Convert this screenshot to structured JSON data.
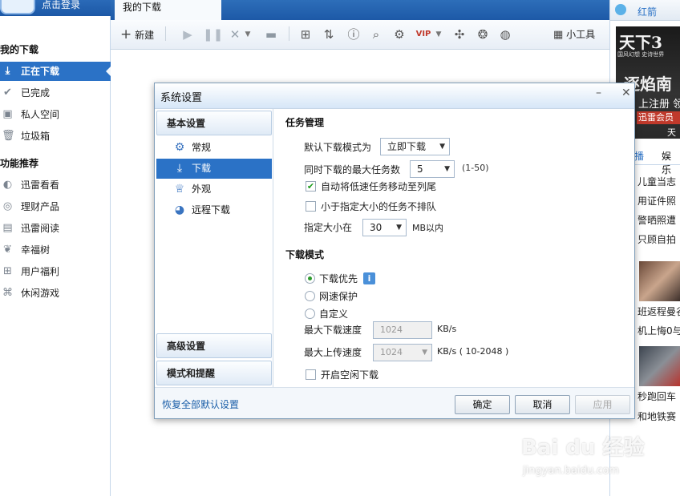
{
  "left": {
    "login": "点击登录",
    "my_downloads_title": "我的下载",
    "downloading": "正在下载",
    "completed": "已完成",
    "private_space": "私人空间",
    "trash": "垃圾箱",
    "recommend_title": "功能推荐",
    "items": [
      "迅雷看看",
      "理财产品",
      "迅雷阅读",
      "幸福树",
      "用户福利",
      "休闲游戏"
    ]
  },
  "tab": {
    "label": "我的下载"
  },
  "toolbar": {
    "new_label": "新建",
    "tools_label": "小工具"
  },
  "right": {
    "tab_label": "红箭",
    "ad_text1": "天下3",
    "ad_text2": "国风幻想 史诗世界",
    "ad_text3": "逐焰南",
    "ad_text4": "上注册 领",
    "ad_text5": "迅雷会员",
    "ad_text6": "天下",
    "tabs": [
      "播",
      "娱乐"
    ],
    "news": [
      "儿童当志",
      "用证件照",
      "警晒照遭",
      "只顾自拍",
      "班返程曼谷",
      "机上悔0与",
      "秒跑回车",
      "和地铁赛"
    ]
  },
  "dialog": {
    "title": "系统设置",
    "sections": {
      "basic": "基本设置",
      "advanced": "高级设置",
      "mode_alerts": "模式和提醒"
    },
    "sub_items": [
      "常规",
      "下载",
      "外观",
      "远程下载"
    ],
    "task_mgmt": "任务管理",
    "default_mode_label": "默认下载模式为",
    "default_mode_value": "立即下载",
    "max_tasks_label": "同时下载的最大任务数",
    "max_tasks_value": "5",
    "max_tasks_range": "(1-50)",
    "auto_move_label": "自动将低速任务移动至列尾",
    "auto_move_checked": true,
    "no_queue_label": "小于指定大小的任务不排队",
    "size_label": "指定大小在",
    "size_value": "30",
    "size_unit": "MB以内",
    "download_mode": "下载模式",
    "mode_priority": "下载优先",
    "mode_protect": "网速保护",
    "mode_custom": "自定义",
    "max_down_label": "最大下载速度",
    "max_down_value": "1024",
    "max_down_unit": "KB/s",
    "max_up_label": "最大上传速度",
    "max_up_value": "1024",
    "max_up_unit": "KB/s ( 10-2048 )",
    "idle_label": "开启空闲下载",
    "restore_label": "恢复全部默认设置",
    "ok_label": "确定",
    "cancel_label": "取消",
    "apply_label": "应用"
  },
  "watermark": {
    "brand": "Bai du 经验",
    "url": "jingyan.baidu.com"
  },
  "colors": {
    "accent": "#2b72c6",
    "titlebar": "#1d59a7"
  }
}
